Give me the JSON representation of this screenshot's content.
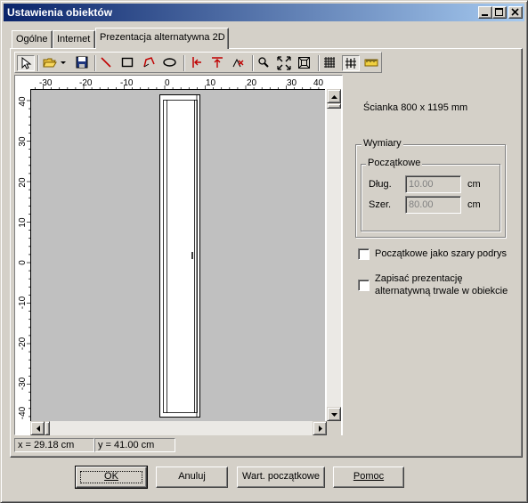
{
  "window": {
    "title": "Ustawienia obiektów",
    "controls": [
      "minimize-icon",
      "maximize-icon",
      "close-icon"
    ]
  },
  "tabs": [
    {
      "label": "Ogólne",
      "active": false
    },
    {
      "label": "Internet",
      "active": false
    },
    {
      "label": "Prezentacja alternatywna 2D",
      "active": true
    }
  ],
  "toolbar": {
    "tools": [
      "pointer-icon",
      "open-folder-icon",
      "dropdown-arrow-icon",
      "save-icon",
      "line-icon",
      "rectangle-icon",
      "polyline-icon",
      "ellipse-icon",
      "align-left-icon",
      "align-top-icon",
      "origin-point-icon",
      "zoom-icon",
      "zoom-extents-icon",
      "zoom-window-icon",
      "grid-icon",
      "snap-icon",
      "ruler-icon"
    ]
  },
  "ruler": {
    "h_labels": [
      "-30",
      "-20",
      "-10",
      "0",
      "10",
      "20",
      "30",
      "40"
    ],
    "v_labels": [
      "40",
      "30",
      "20",
      "10",
      "0",
      "-10",
      "-20",
      "-30",
      "-40"
    ]
  },
  "status": {
    "x": "x = 29.18 cm",
    "y": "y = 41.00 cm"
  },
  "panel": {
    "object_name": "Ścianka 800 x 1195 mm",
    "dimensions_group": "Wymiary",
    "initial_group": "Początkowe",
    "length_label": "Dług.",
    "length_value": "10.00",
    "length_unit": "cm",
    "width_label": "Szer.",
    "width_value": "80.00",
    "width_unit": "cm",
    "checkbox_gray_underlay": "Początkowe jako szary podrys",
    "checkbox_save_line1": "Zapisać prezentację",
    "checkbox_save_line2": "alternatywną trwale w obiekcie",
    "checkbox_gray_checked": false,
    "checkbox_save_checked": false
  },
  "buttons": {
    "ok": "OK",
    "cancel": "Anuluj",
    "defaults": "Wart. początkowe",
    "help": "Pomoc"
  }
}
